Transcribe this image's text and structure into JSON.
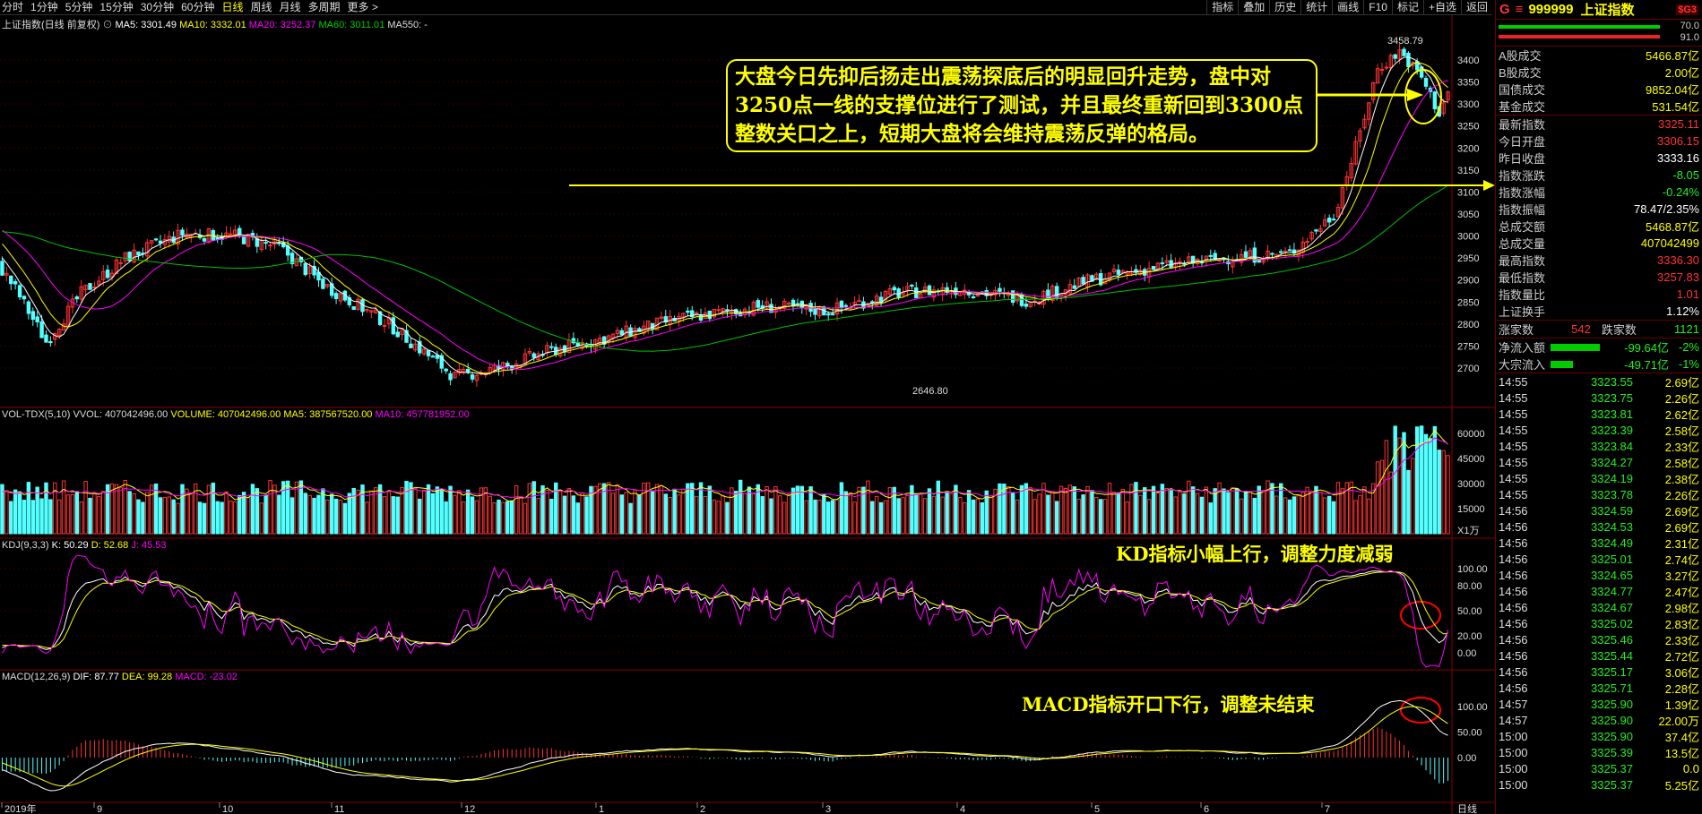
{
  "toolbar": {
    "periods": [
      "分时",
      "1分钟",
      "5分钟",
      "15分钟",
      "30分钟",
      "60分钟",
      "日线",
      "周线",
      "月线",
      "多周期",
      "更多 >"
    ],
    "active_period": "日线",
    "right_tools": [
      "指标",
      "叠加",
      "历史",
      "统计",
      "画线",
      "F10",
      "标记",
      "+自选",
      "返回"
    ]
  },
  "main_indicator": {
    "name": "上证指数(日线 前复权)",
    "ma5": "MA5: 3301.49",
    "ma10": "MA10: 3332.01",
    "ma20": "MA20: 3252.37",
    "ma60": "MA60: 3011.01",
    "ma550": "MA550: -"
  },
  "price_axis": [
    "3400",
    "3350",
    "3300",
    "3250",
    "3200",
    "3150",
    "3100",
    "3050",
    "3000",
    "2950",
    "2900",
    "2850",
    "2800",
    "2750",
    "2700"
  ],
  "high_label": "3458.79",
  "low_label": "2646.80",
  "vol_indicator": {
    "name": "VOL-TDX(5,10)",
    "vvol": "VVOL: 407042496.00",
    "volume": "VOLUME: 407042496.00",
    "ma5": "MA5: 387567520.00",
    "ma10": "MA10: 457781952.00"
  },
  "vol_axis": [
    "60000",
    "45000",
    "30000",
    "15000"
  ],
  "vol_unit": "X1万",
  "kdj_indicator": {
    "name": "KDJ(9,3,3)",
    "k": "K: 50.29",
    "d": "D: 52.68",
    "j": "J: 45.53"
  },
  "kdj_axis": [
    "100.00",
    "80.00",
    "50.00",
    "20.00",
    "0.00"
  ],
  "macd_indicator": {
    "name": "MACD(12,26,9)",
    "dif": "DIF: 87.77",
    "dea": "DEA: 99.28",
    "macd": "MACD: -23.02"
  },
  "macd_axis": [
    "100.00",
    "50.00",
    "0.00"
  ],
  "date_axis": [
    "2019年",
    "9",
    "10",
    "11",
    "12",
    "1",
    "2",
    "3",
    "4",
    "5",
    "6",
    "7"
  ],
  "date_axis_right": "日线",
  "annotations": {
    "main": "大盘今日先抑后扬走出震荡探底后的明显回升走势，盘中对3250点一线的支撑位进行了测试，并且最终重新回到3300点整数关口之上，短期大盘将会维持震荡反弹的格局。",
    "kdj": "KD指标小幅上行，调整力度减弱",
    "macd": "MACD指标开口下行，调整未结束"
  },
  "quote": {
    "g": "G",
    "code": "999999",
    "name": "上证指数",
    "tag": "$G3",
    "ratio_top": "70.0",
    "ratio_bottom": "91.0",
    "stats1": [
      {
        "label": "A股成交",
        "value": "5466.87亿"
      },
      {
        "label": "B股成交",
        "value": "2.00亿"
      },
      {
        "label": "国债成交",
        "value": "9852.04亿"
      },
      {
        "label": "基金成交",
        "value": "531.54亿"
      }
    ],
    "stats2": [
      {
        "label": "最新指数",
        "value": "3325.11",
        "color": "#ff3333"
      },
      {
        "label": "今日开盘",
        "value": "3306.15",
        "color": "#ff3333"
      },
      {
        "label": "昨日收盘",
        "value": "3333.16",
        "color": "#ffffff"
      },
      {
        "label": "指数涨跌",
        "value": "-8.05",
        "color": "#22ee22"
      },
      {
        "label": "指数涨幅",
        "value": "-0.24%",
        "color": "#22ee22"
      },
      {
        "label": "指数振幅",
        "value": "78.47/2.35%",
        "color": "#ffffff"
      },
      {
        "label": "总成交额",
        "value": "5468.87亿",
        "color": "#ffff00"
      },
      {
        "label": "总成交量",
        "value": "407042499",
        "color": "#ffff00"
      },
      {
        "label": "最高指数",
        "value": "3336.30",
        "color": "#ff3333"
      },
      {
        "label": "最低指数",
        "value": "3257.83",
        "color": "#ff3333"
      },
      {
        "label": "指数量比",
        "value": "1.01",
        "color": "#ff3333"
      },
      {
        "label": "上证换手",
        "value": "1.12%",
        "color": "#ffffff"
      }
    ],
    "rise_label": "涨家数",
    "rise_value": "542",
    "fall_label": "跌家数",
    "fall_value": "1121",
    "flow": [
      {
        "label": "净流入额",
        "value": "-99.64亿",
        "pct": "-2%"
      },
      {
        "label": "大宗流入",
        "value": "-49.71亿",
        "pct": "-1%"
      }
    ],
    "ticks": [
      {
        "t": "14:55",
        "p": "3323.55",
        "v": "2.69亿"
      },
      {
        "t": "14:55",
        "p": "3323.75",
        "v": "2.26亿"
      },
      {
        "t": "14:55",
        "p": "3323.81",
        "v": "2.62亿"
      },
      {
        "t": "14:55",
        "p": "3323.39",
        "v": "2.58亿"
      },
      {
        "t": "14:55",
        "p": "3323.84",
        "v": "2.33亿"
      },
      {
        "t": "14:55",
        "p": "3324.27",
        "v": "2.58亿"
      },
      {
        "t": "14:55",
        "p": "3324.19",
        "v": "2.38亿"
      },
      {
        "t": "14:55",
        "p": "3323.78",
        "v": "2.26亿"
      },
      {
        "t": "14:56",
        "p": "3324.59",
        "v": "2.69亿"
      },
      {
        "t": "14:56",
        "p": "3324.53",
        "v": "2.69亿"
      },
      {
        "t": "14:56",
        "p": "3324.49",
        "v": "2.31亿"
      },
      {
        "t": "14:56",
        "p": "3325.01",
        "v": "2.74亿"
      },
      {
        "t": "14:56",
        "p": "3324.65",
        "v": "3.27亿"
      },
      {
        "t": "14:56",
        "p": "3324.77",
        "v": "2.47亿"
      },
      {
        "t": "14:56",
        "p": "3324.67",
        "v": "2.98亿"
      },
      {
        "t": "14:56",
        "p": "3325.02",
        "v": "2.83亿"
      },
      {
        "t": "14:56",
        "p": "3325.46",
        "v": "2.33亿"
      },
      {
        "t": "14:56",
        "p": "3325.44",
        "v": "2.72亿"
      },
      {
        "t": "14:56",
        "p": "3325.17",
        "v": "3.06亿"
      },
      {
        "t": "14:56",
        "p": "3325.71",
        "v": "2.28亿"
      },
      {
        "t": "14:57",
        "p": "3325.90",
        "v": "1.39亿"
      },
      {
        "t": "14:57",
        "p": "3325.90",
        "v": "22.00万"
      },
      {
        "t": "15:00",
        "p": "3325.90",
        "v": "37.4亿"
      },
      {
        "t": "15:00",
        "p": "3325.39",
        "v": "13.5亿"
      },
      {
        "t": "15:00",
        "p": "3325.37",
        "v": "0.0"
      },
      {
        "t": "15:00",
        "p": "3325.37",
        "v": "5.25亿"
      }
    ]
  },
  "colors": {
    "up": "#ff3333",
    "down": "#54ffff",
    "ma5": "#ffffff",
    "ma10": "#ffff00",
    "ma20": "#ff00ff",
    "ma60": "#00c000",
    "grid": "#550000"
  }
}
